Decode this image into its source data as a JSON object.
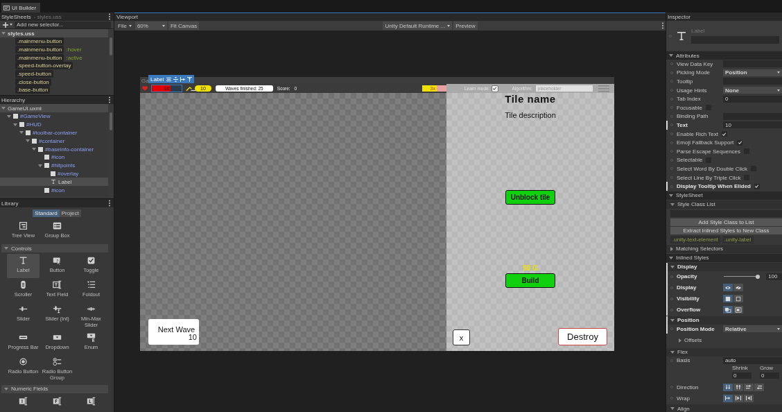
{
  "title_tab": "UI Builder",
  "stylesheets": {
    "title": "StyleSheets",
    "subtitle": "- styles.uss",
    "selector_placeholder": "Add new selector...",
    "file": "styles.uss",
    "expanded": true,
    "selectors": [
      {
        "name": ".mainmenu-button"
      },
      {
        "name": ".mainmenu-button",
        "pseudo": ":hover"
      },
      {
        "name": ".mainmenu-button",
        "pseudo": ":active"
      },
      {
        "name": ".speed-button-overlay"
      },
      {
        "name": ".speed-button"
      },
      {
        "name": ".close-button"
      },
      {
        "name": ".base-button"
      }
    ]
  },
  "hierarchy": {
    "title": "Hierarchy",
    "file": "GameUI.uxml",
    "expanded": true,
    "nodes": [
      {
        "label": "#GameView",
        "kind": "element",
        "expanded": true,
        "selected": false,
        "children": [
          {
            "label": "#HUD",
            "kind": "element",
            "expanded": true,
            "selected": false,
            "children": [
              {
                "label": "#toolbar-container",
                "kind": "element",
                "expanded": true,
                "selected": false,
                "children": [
                  {
                    "label": "#container",
                    "kind": "element",
                    "expanded": true,
                    "selected": false,
                    "children": [
                      {
                        "label": "#baseinfo-container",
                        "kind": "element",
                        "expanded": true,
                        "selected": false,
                        "children": [
                          {
                            "label": "#icon",
                            "kind": "element",
                            "selected": false
                          },
                          {
                            "label": "#hitpoints",
                            "kind": "element",
                            "expanded": true,
                            "selected": false,
                            "children": [
                              {
                                "label": "#overlay",
                                "kind": "element",
                                "selected": false
                              },
                              {
                                "label": "Label",
                                "kind": "label",
                                "selected": true
                              }
                            ]
                          },
                          {
                            "label": "#icon",
                            "kind": "element",
                            "selected": false
                          }
                        ]
                      }
                    ]
                  }
                ]
              }
            ]
          }
        ]
      }
    ]
  },
  "library": {
    "title": "Library",
    "tabs": [
      {
        "label": "Standard",
        "selected": true
      },
      {
        "label": "Project",
        "selected": false
      }
    ],
    "items": [
      {
        "kind": "tree-view",
        "label": "Tree View",
        "selected": false
      },
      {
        "kind": "group-box",
        "label": "Group Box",
        "selected": false
      }
    ],
    "sections": [
      {
        "title": "Controls",
        "expanded": true,
        "items": [
          {
            "kind": "label",
            "label": "Label",
            "selected": true
          },
          {
            "kind": "button",
            "label": "Button",
            "selected": false
          },
          {
            "kind": "toggle",
            "label": "Toggle",
            "selected": false
          },
          {
            "kind": "scroller",
            "label": "Scroller",
            "selected": false
          },
          {
            "kind": "text-field",
            "label": "Text Field",
            "selected": false
          },
          {
            "kind": "foldout",
            "label": "Foldout",
            "selected": false
          },
          {
            "kind": "slider",
            "label": "Slider",
            "selected": false
          },
          {
            "kind": "slider-int",
            "label": "Slider (Int)",
            "selected": false
          },
          {
            "kind": "min-max-slider",
            "label": "Min-Max Slider",
            "selected": false
          },
          {
            "kind": "progress-bar",
            "label": "Progress Bar",
            "selected": false
          },
          {
            "kind": "dropdown",
            "label": "Dropdown",
            "selected": false
          },
          {
            "kind": "enum",
            "label": "Enum",
            "selected": false
          },
          {
            "kind": "radio-button",
            "label": "Radio Button",
            "selected": false
          },
          {
            "kind": "radio-button-group",
            "label": "Radio Button Group",
            "selected": false
          }
        ]
      },
      {
        "title": "Numeric Fields",
        "expanded": true,
        "items": [
          {
            "kind": "integer",
            "selected": false
          },
          {
            "kind": "float",
            "selected": false
          },
          {
            "kind": "long",
            "selected": false
          }
        ]
      }
    ]
  },
  "viewport": {
    "title": "Viewport",
    "menu": "File",
    "zoom": "60%",
    "fit": "Fit Canvas",
    "theme": "Unity Default Runtime ...",
    "preview": "Preview",
    "canvas": {
      "title": "Ga",
      "selection": "Label",
      "hud": {
        "hitpoints": {
          "value": "10",
          "level": 0.55
        },
        "speed": "10",
        "waves": "Waves finished: 25",
        "score_label": "Score:",
        "score": "0",
        "speed_button": "3x",
        "learn_mode": {
          "label": "Learn mode:",
          "checked": true
        },
        "algorithm": {
          "label": "Algorithm:",
          "placeholder": "placeholder"
        }
      },
      "tile": {
        "name": "Tile name",
        "description": "Tile description",
        "unblock": "Unblock tile",
        "cost": "50 G",
        "build": "Build",
        "close": "x",
        "destroy": "Destroy"
      },
      "next_wave": {
        "label": "Next Wave",
        "count": "10"
      }
    }
  },
  "inspector": {
    "title": "Inspector",
    "element_type": "Label",
    "rows": [
      {
        "kind": "header",
        "label": "Attributes",
        "expanded": true
      },
      {
        "kind": "text",
        "label": "View Data Key",
        "overridden": false
      },
      {
        "kind": "dropdown",
        "label": "Picking Mode",
        "value": "Position",
        "overridden": false
      },
      {
        "kind": "text",
        "label": "Tooltip",
        "overridden": false
      },
      {
        "kind": "dropdown",
        "label": "Usage Hints",
        "value": "None",
        "overridden": false
      },
      {
        "kind": "text",
        "label": "Tab Index",
        "value": "0",
        "overridden": false
      },
      {
        "kind": "checkbox",
        "label": "Focusable",
        "checked": false,
        "overridden": false
      },
      {
        "kind": "text",
        "label": "Binding Path",
        "overridden": false
      },
      {
        "kind": "text",
        "label": "Text",
        "value": "10",
        "overridden": true
      },
      {
        "kind": "checkbox",
        "label": "Enable Rich Text",
        "checked": true,
        "overridden": false
      },
      {
        "kind": "checkbox",
        "label": "Emoji Fallback Support",
        "checked": true,
        "overridden": false
      },
      {
        "kind": "checkbox",
        "label": "Parse Escape Sequences",
        "checked": false,
        "overridden": false
      },
      {
        "kind": "checkbox",
        "label": "Selectable",
        "checked": false,
        "overridden": false
      },
      {
        "kind": "checkbox",
        "label": "Select Word By Double Click",
        "checked": false,
        "overridden": false
      },
      {
        "kind": "checkbox",
        "label": "Select Line By Triple Click",
        "checked": false,
        "overridden": false
      },
      {
        "kind": "checkbox",
        "label": "Display Tooltip When Elided",
        "checked": true,
        "overridden": true
      },
      {
        "kind": "header",
        "label": "StyleSheet",
        "expanded": true
      },
      {
        "kind": "subheader",
        "label": "Style Class List",
        "expanded": true,
        "overridden": false
      },
      {
        "kind": "field"
      },
      {
        "kind": "button",
        "label": "Add Style Class to List"
      },
      {
        "kind": "button",
        "label": "Extract Inlined Styles to New Class"
      },
      {
        "kind": "tags",
        "tags": [
          ".unity-text-element",
          ".unity-label"
        ]
      },
      {
        "kind": "subheader",
        "label": "Matching Selectors",
        "expanded": false,
        "overridden": false
      },
      {
        "kind": "header",
        "label": "Inlined Styles",
        "expanded": true
      },
      {
        "kind": "subheader",
        "label": "Display",
        "expanded": true,
        "overridden": true
      },
      {
        "kind": "slider",
        "label": "Opacity",
        "level": 1,
        "value": "100",
        "overridden": true
      },
      {
        "kind": "toggles",
        "label": "Display",
        "overridden": true,
        "options": [
          {
            "kind": "eye",
            "selected": true
          },
          {
            "kind": "eye-off",
            "selected": false
          }
        ]
      },
      {
        "kind": "toggles",
        "label": "Visibility",
        "overridden": true,
        "options": [
          {
            "kind": "filled",
            "selected": true
          },
          {
            "kind": "outline",
            "selected": false
          }
        ]
      },
      {
        "kind": "toggles",
        "label": "Overflow",
        "overridden": true,
        "options": [
          {
            "kind": "overflow-visible",
            "selected": true
          },
          {
            "kind": "overflow-hidden",
            "selected": false
          }
        ]
      },
      {
        "kind": "subheader",
        "label": "Position",
        "expanded": true,
        "overridden": true
      },
      {
        "kind": "dropdown",
        "label": "Position Mode",
        "value": "Relative",
        "overridden": true
      },
      {
        "kind": "foldout",
        "label": "Offsets",
        "expanded": false
      },
      {
        "kind": "subheader",
        "label": "Flex",
        "expanded": true,
        "overridden": false
      },
      {
        "kind": "text",
        "label": "Basis",
        "value": "auto",
        "overridden": false
      },
      {
        "kind": "pair",
        "items": [
          {
            "label": "Shrink",
            "value": "0"
          },
          {
            "label": "Grow",
            "value": "0"
          }
        ]
      },
      {
        "kind": "toggles",
        "label": "Direction",
        "overridden": false,
        "options": [
          {
            "kind": "column",
            "selected": true
          },
          {
            "kind": "column-reverse",
            "selected": false
          },
          {
            "kind": "row",
            "selected": false
          },
          {
            "kind": "row-reverse",
            "selected": false
          }
        ]
      },
      {
        "kind": "toggles",
        "label": "Wrap",
        "overridden": false,
        "options": [
          {
            "kind": "nowrap",
            "selected": true
          },
          {
            "kind": "wrap",
            "selected": false
          },
          {
            "kind": "wrap-reverse",
            "selected": false
          }
        ]
      },
      {
        "kind": "subheader",
        "label": "Align",
        "expanded": true,
        "overridden": false
      }
    ]
  }
}
